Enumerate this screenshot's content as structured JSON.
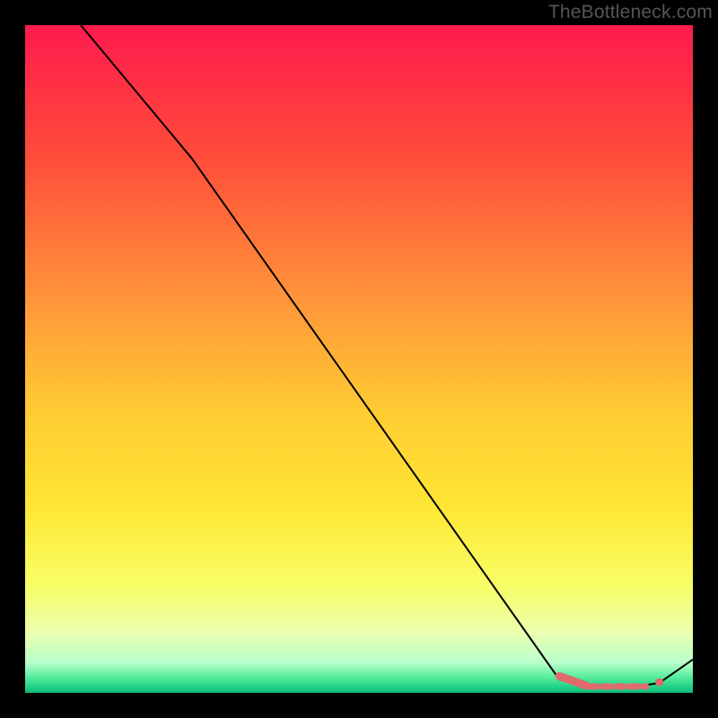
{
  "watermark": "TheBottleneck.com",
  "chart_data": {
    "type": "line",
    "title": "",
    "xlabel": "",
    "ylabel": "",
    "xlim": [
      0,
      100
    ],
    "ylim": [
      0,
      100
    ],
    "series": [
      {
        "name": "curve",
        "points": [
          {
            "x": 0,
            "y": 110
          },
          {
            "x": 25,
            "y": 80
          },
          {
            "x": 80,
            "y": 2
          },
          {
            "x": 84,
            "y": 1
          },
          {
            "x": 92,
            "y": 1
          },
          {
            "x": 95,
            "y": 1.5
          },
          {
            "x": 100,
            "y": 5
          }
        ]
      }
    ],
    "highlights": [
      {
        "name": "valley-left",
        "shape": "rounded-bar",
        "points": [
          {
            "x": 80,
            "y": 2.5
          },
          {
            "x": 84,
            "y": 1.1
          }
        ],
        "color": "#e26a6d"
      },
      {
        "name": "valley-floor-dash",
        "shape": "dash",
        "points": [
          {
            "x": 84.5,
            "y": 0.95
          },
          {
            "x": 93.0,
            "y": 0.95
          }
        ],
        "color": "#e26a6d"
      },
      {
        "name": "valley-right-dot",
        "shape": "dot",
        "points": [
          {
            "x": 95,
            "y": 1.6
          }
        ],
        "color": "#e26a6d"
      }
    ],
    "gradient_stops": [
      {
        "offset": 0.0,
        "color": "#ff1a4d"
      },
      {
        "offset": 0.2,
        "color": "#ff4d3a"
      },
      {
        "offset": 0.4,
        "color": "#ff913a"
      },
      {
        "offset": 0.58,
        "color": "#ffcc33"
      },
      {
        "offset": 0.72,
        "color": "#ffe633"
      },
      {
        "offset": 0.84,
        "color": "#f7ff66"
      },
      {
        "offset": 0.91,
        "color": "#eaffb0"
      },
      {
        "offset": 0.955,
        "color": "#b8ffcc"
      },
      {
        "offset": 0.975,
        "color": "#5eeea0"
      },
      {
        "offset": 0.99,
        "color": "#25d38a"
      },
      {
        "offset": 1.0,
        "color": "#0fb877"
      }
    ]
  }
}
